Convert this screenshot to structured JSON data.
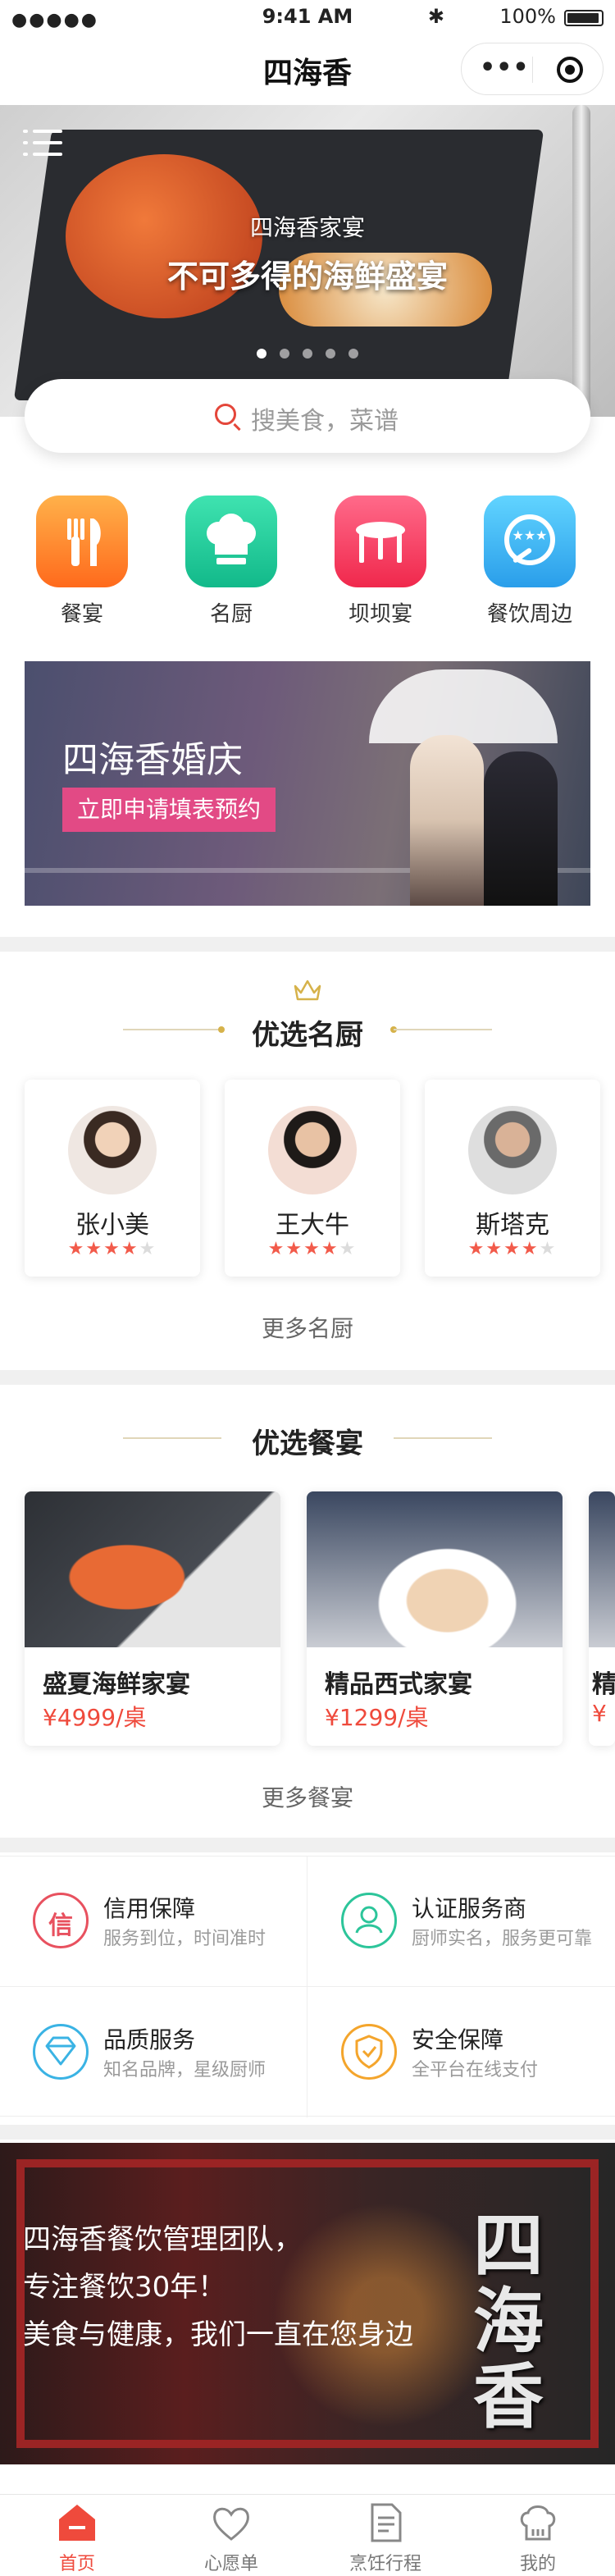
{
  "status_bar": {
    "signal": "●●●●●",
    "time": "9:41 AM",
    "battery": "100%",
    "bluetooth": "✱"
  },
  "nav": {
    "title": "四海香",
    "more_icon": "•••"
  },
  "hero": {
    "subtitle": "四海香家宴",
    "title": "不可多得的海鲜盛宴",
    "page_count": 5,
    "active_page": 1
  },
  "search": {
    "placeholder": "搜美食，菜谱"
  },
  "categories": [
    {
      "label": "餐宴",
      "icon": "fork-knife-icon",
      "color": "#ff7a22"
    },
    {
      "label": "名厨",
      "icon": "chef-hat-icon",
      "color": "#17bf8f"
    },
    {
      "label": "坝坝宴",
      "icon": "table-icon",
      "color": "#f22d55"
    },
    {
      "label": "餐饮周边",
      "icon": "star-plate-icon",
      "color": "#2ea1ec"
    }
  ],
  "wedding_banner": {
    "title": "四海香婚庆",
    "cta": "立即申请填表预约"
  },
  "chefs_section": {
    "title": "优选名厨",
    "more": "更多名厨",
    "chefs": [
      {
        "name": "张小美",
        "rating": 4,
        "max": 5
      },
      {
        "name": "王大牛",
        "rating": 4,
        "max": 5
      },
      {
        "name": "斯塔克",
        "rating": 4,
        "max": 5
      }
    ]
  },
  "banquets_section": {
    "title": "优选餐宴",
    "more": "更多餐宴",
    "items": [
      {
        "name": "盛夏海鲜家宴",
        "price": "¥4999/桌"
      },
      {
        "name": "精品西式家宴",
        "price": "¥1299/桌"
      },
      {
        "name": "精",
        "price": "¥"
      }
    ]
  },
  "services": [
    {
      "title": "信用保障",
      "desc": "服务到位，时间准时",
      "icon": "credit-icon",
      "color": "#e8515f"
    },
    {
      "title": "认证服务商",
      "desc": "厨师实名，服务更可靠",
      "icon": "certified-user-icon",
      "color": "#2cc59a"
    },
    {
      "title": "品质服务",
      "desc": "知名品牌，星级厨师",
      "icon": "diamond-icon",
      "color": "#3ab3e4"
    },
    {
      "title": "安全保障",
      "desc": "全平台在线支付",
      "icon": "shield-check-icon",
      "color": "#f4a52c"
    }
  ],
  "promo": {
    "line1": "四海香餐饮管理团队，",
    "line2": "专注餐饮30年！",
    "line3": "美食与健康，我们一直在您身边",
    "logo": "四海香"
  },
  "tabbar": [
    {
      "label": "首页",
      "icon": "home-icon",
      "active": true
    },
    {
      "label": "心愿单",
      "icon": "heart-icon",
      "active": false
    },
    {
      "label": "烹饪行程",
      "icon": "document-icon",
      "active": false
    },
    {
      "label": "我的",
      "icon": "chef-hat-icon",
      "active": false
    }
  ],
  "colors": {
    "accent": "#ef4a3c",
    "gold": "#d6b24a",
    "divider": "#f0f0f0"
  }
}
